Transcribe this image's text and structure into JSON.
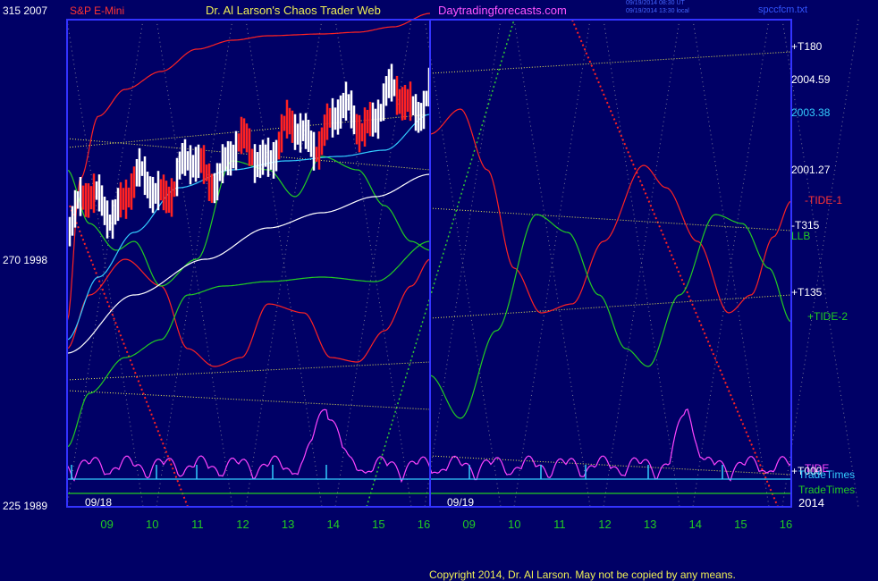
{
  "header": {
    "left_scale": "315  2007",
    "instrument": "S&P E-Mini",
    "title": "Dr. Al Larson's Chaos Trader Web",
    "site": "Daytradingforecasts.com",
    "timestamp_1": "09/19/2014 08:30 UT",
    "timestamp_2": "09/19/2014 13:30 local",
    "file": "spccfcm.txt"
  },
  "left_axis": {
    "mid": "270  1998",
    "bottom": "225  1989"
  },
  "right_labels": {
    "t180": "+T180",
    "p1": "2004.59",
    "p2": "2003.38",
    "p3": "2001.27",
    "tide1": "-TIDE-1",
    "t315": "-T315",
    "llb": "LLB",
    "t135": "+T135",
    "tide2": "+TIDE-2",
    "t000": "+T000",
    "tide_overlap": "TIDE",
    "tradetimes1": "TradeTimes",
    "tradetimes2": "TradeTimes",
    "year": "2014"
  },
  "date_labels": {
    "d1": "09/18",
    "d2": "09/19"
  },
  "footer": {
    "copyright": "Copyright 2014, Dr. Al Larson. May not be copied by any means."
  },
  "colors": {
    "background": "#000066",
    "frame": "#3333ff",
    "red": "#ff2222",
    "green": "#22cc22",
    "yellow": "#eeee55",
    "cyan": "#22cccc",
    "magenta": "#ff44ff",
    "white": "#ffffff"
  },
  "chart_data": {
    "type": "line",
    "title": "Dr. Al Larson's Chaos Trader Web",
    "subtitle": "S&P E-Mini",
    "x_ticks": [
      "09",
      "10",
      "11",
      "12",
      "13",
      "14",
      "15",
      "16",
      "09",
      "10",
      "11",
      "12",
      "13",
      "14",
      "15",
      "16"
    ],
    "day_labels": [
      "09/18",
      "09/19"
    ],
    "y_left_ticks": [
      {
        "label": "315  2007",
        "value": 2007
      },
      {
        "label": "270  1998",
        "value": 1998
      },
      {
        "label": "225  1989",
        "value": 1989
      }
    ],
    "ylim": [
      1989,
      2007
    ],
    "price_levels": [
      {
        "label": "2004.59",
        "value": 2004.59
      },
      {
        "label": "2003.38",
        "value": 2003.38
      },
      {
        "label": "2001.27",
        "value": 2001.27
      }
    ],
    "series": [
      {
        "name": "-TIDE-1"
      },
      {
        "name": "+TIDE-2"
      },
      {
        "name": "LLB"
      },
      {
        "name": "+T180"
      },
      {
        "name": "-T315"
      },
      {
        "name": "+T135"
      },
      {
        "name": "+T000"
      },
      {
        "name": "TradeTimes"
      }
    ]
  }
}
